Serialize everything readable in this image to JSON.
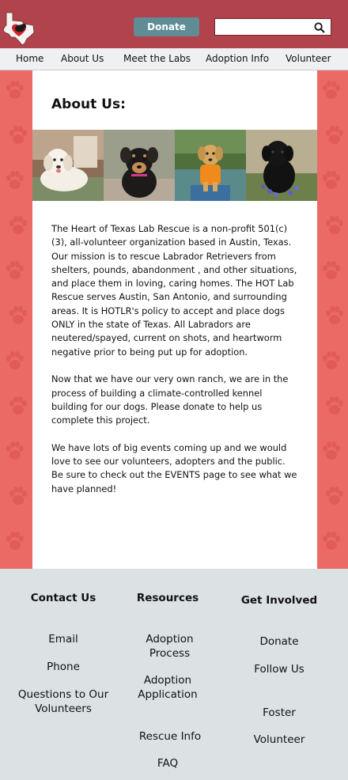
{
  "header": {
    "donate_label": "Donate",
    "search_placeholder": ""
  },
  "nav": {
    "items": [
      "Home",
      "About Us",
      "Meet the Labs",
      "Adoption Info",
      "Volunteer"
    ]
  },
  "main": {
    "title": "About Us:",
    "paragraphs": [
      "The Heart of Texas Lab Rescue is a non-profit 501(c)(3), all-volunteer organization based in Austin, Texas. Our mission is to rescue Labrador Retrievers from shelters, pounds, abandonment , and other situations, and place them in loving, caring homes. The HOT Lab Rescue serves Austin, San Antonio, and surrounding areas. It is HOTLR's policy to accept and place dogs ONLY in the state of Texas. All Labradors are neutered/spayed, current on shots, and heartworm negative prior to being put up for adoption.",
      "Now that we have our very own ranch, we are in the process of building a climate-controlled kennel building for our dogs. Please donate to help us complete this project.",
      "We have lots of big events coming up and we would love to see our volunteers, adopters and the public. Be sure to check out the EVENTS page to see what we have planned!"
    ]
  },
  "footer": {
    "contact": {
      "heading": "Contact Us",
      "links": [
        "Email",
        "Phone",
        "Questions to Our Volunteers"
      ]
    },
    "resources": {
      "heading": "Resources",
      "links": [
        "Adoption Process",
        "Adoption Application",
        "Rescue Info",
        "FAQ"
      ]
    },
    "involved": {
      "heading": "Get Involved",
      "links": [
        "Donate",
        "Follow Us",
        "Foster",
        "Volunteer"
      ]
    }
  },
  "colors": {
    "header_bg": "#b0434b",
    "donate_bg": "#5f8c95",
    "page_bg": "#eb6a66",
    "footer_bg": "#dce2e4"
  }
}
